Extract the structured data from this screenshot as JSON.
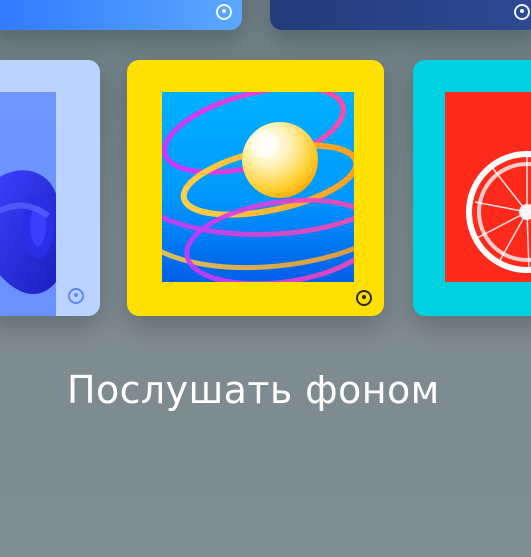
{
  "section": {
    "title": "Послушать фоном"
  },
  "tiles": {
    "top_left": {
      "badge_icon": "vinyl-badge-icon",
      "color": "#3f8fff"
    },
    "top_right": {
      "badge_icon": "vinyl-badge-icon",
      "color": "#273f82"
    },
    "row": [
      {
        "id": "yoga-mat",
        "frame_color": "#bcd3ff",
        "art_icon": "yoga-mat-icon",
        "badge_icon": "vinyl-badge-icon"
      },
      {
        "id": "ball-rings",
        "frame_color": "#ffe000",
        "art_icon": "ball-rings-icon",
        "badge_icon": "vinyl-badge-icon"
      },
      {
        "id": "bicycle-wheel",
        "frame_color": "#00d0e0",
        "art_icon": "bicycle-wheel-icon",
        "badge_icon": "vinyl-badge-icon"
      }
    ]
  }
}
